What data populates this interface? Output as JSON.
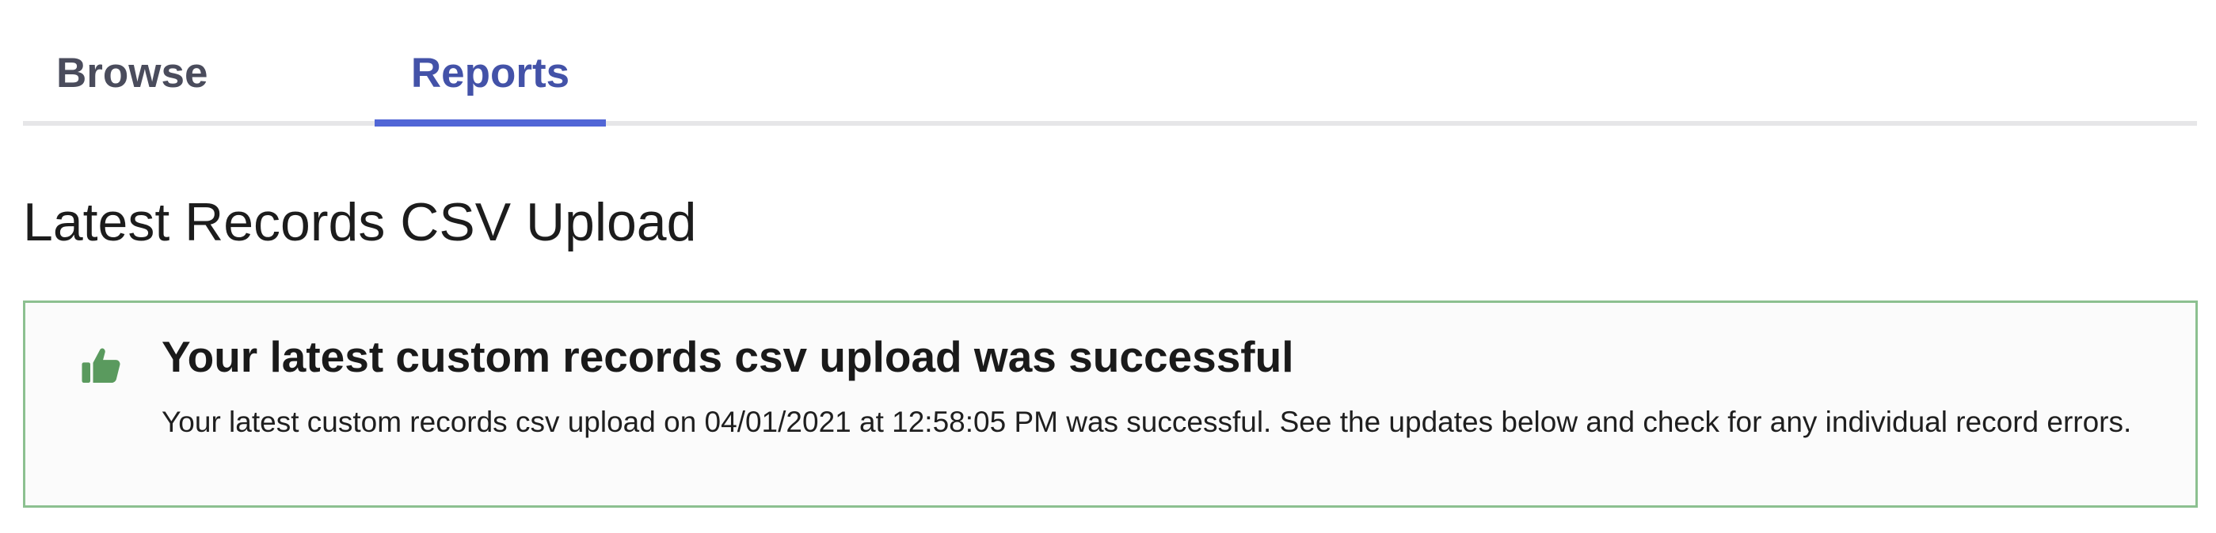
{
  "tabs": [
    {
      "label": "Browse",
      "active": false
    },
    {
      "label": "Reports",
      "active": true
    }
  ],
  "page": {
    "title": "Latest Records CSV Upload"
  },
  "alert": {
    "icon": "thumbs-up-icon",
    "status": "success",
    "heading": "Your latest custom records csv upload was successful",
    "body": "Your latest custom records csv upload on 04/01/2021 at 12:58:05 PM was successful. See the updates below and check for any individual record errors."
  },
  "colors": {
    "active_tab_text": "#4352a8",
    "active_tab_underline": "#5166d6",
    "inactive_tab_text": "#4a4c5c",
    "success_border": "#8cc090",
    "success_icon": "#5a9a5e"
  }
}
